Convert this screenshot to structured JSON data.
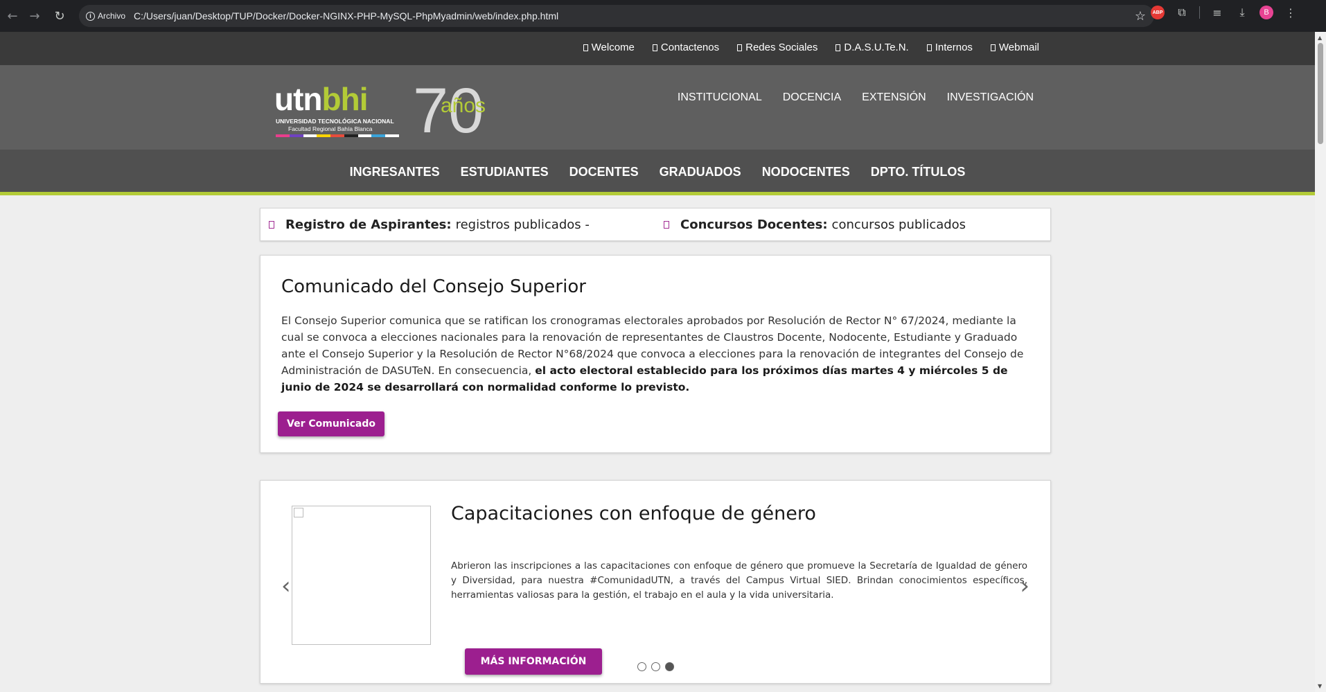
{
  "browser": {
    "site_chip": "Archivo",
    "url": "C:/Users/juan/Desktop/TUP/Docker/Docker-NGINX-PHP-MySQL-PhpMyadmin/web/index.php.html",
    "abp_label": "ABP",
    "profile_initial": "B"
  },
  "top_links": [
    {
      "label": "Welcome"
    },
    {
      "label": "Contactenos"
    },
    {
      "label": "Redes Sociales"
    },
    {
      "label": "D.A.S.U.Te.N."
    },
    {
      "label": "Internos"
    },
    {
      "label": "Webmail"
    }
  ],
  "logo": {
    "utn": "utn",
    "bhi": "bhi",
    "line1": "UNIVERSIDAD TECNOLÓGICA NACIONAL",
    "line2": "Facultad Regional Bahía Blanca",
    "seventy": "70",
    "anos": "años"
  },
  "main_menu": [
    {
      "label": "INSTITUCIONAL"
    },
    {
      "label": "DOCENCIA"
    },
    {
      "label": "EXTENSIÓN"
    },
    {
      "label": "INVESTIGACIÓN"
    }
  ],
  "nav": [
    {
      "label": "INGRESANTES"
    },
    {
      "label": "ESTUDIANTES"
    },
    {
      "label": "DOCENTES"
    },
    {
      "label": "GRADUADOS"
    },
    {
      "label": "NODOCENTES"
    },
    {
      "label": "DPTO. TÍTULOS"
    }
  ],
  "ticker": [
    {
      "title": "Registro de Aspirantes:",
      "text": "registros publicados -"
    },
    {
      "title": "Concursos Docentes:",
      "text": "concursos publicados"
    }
  ],
  "notice": {
    "title": "Comunicado del Consejo Superior",
    "body": "El Consejo Superior comunica que se ratifican los cronogramas electorales aprobados por Resolución de Rector N° 67/2024, mediante la cual se convoca a elecciones nacionales para la renovación de representantes de Claustros Docente, Nodocente, Estudiante y Graduado ante el Consejo Superior y la Resolución de Rector N°68/2024 que convoca a elecciones para la renovación de integrantes del Consejo de Administración de DASUTeN. En consecuencia,",
    "body_bold": "el acto electoral establecido para los próximos días martes 4 y miércoles 5 de junio de 2024 se desarrollará con normalidad conforme lo previsto.",
    "button": "Ver Comunicado"
  },
  "carousel": {
    "title": "Capacitaciones con enfoque de género",
    "text": "Abrieron las inscripciones a las capacitaciones con enfoque de género que promueve la Secretaría de Igualdad de género y Diversidad, para nuestra #ComunidadUTN, a través del Campus Virtual SIED. Brindan conocimientos específicos, herramientas valiosas para la gestión, el trabajo en el aula y la vida universitaria.",
    "button": "MÁS INFORMACIÓN",
    "slide_count": 3,
    "active_slide": 3
  },
  "colors": {
    "accent": "#9c1f8f",
    "brand_green": "#b3cb37"
  }
}
